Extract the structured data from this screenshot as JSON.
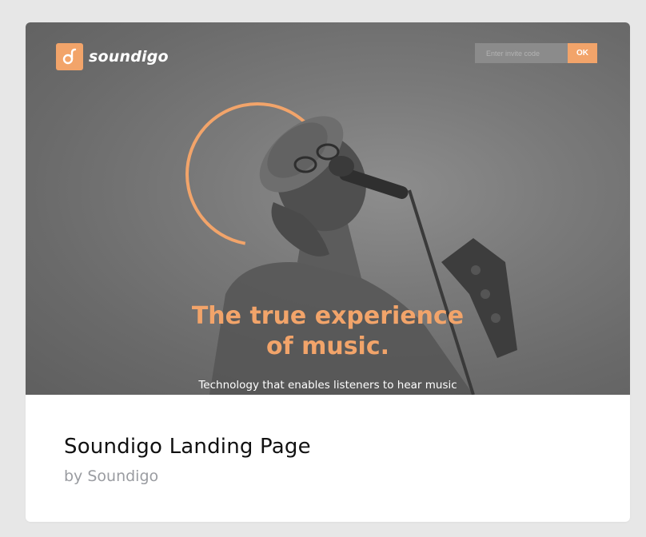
{
  "preview": {
    "brand": {
      "icon": "soundigo-logo-icon",
      "name": "soundigo"
    },
    "invite": {
      "placeholder": "Enter invite code",
      "button_label": "OK"
    },
    "headline": {
      "line1": "The true experience",
      "line2": "of music."
    },
    "tagline": "Technology that enables listeners to hear music",
    "accent_color": "#f2a46a",
    "photo": "singer-with-microphone-photo"
  },
  "card": {
    "title": "Soundigo Landing Page",
    "byline": "by Soundigo"
  }
}
